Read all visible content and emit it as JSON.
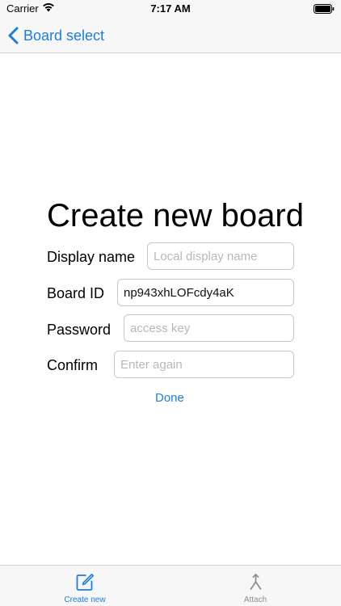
{
  "status_bar": {
    "carrier": "Carrier",
    "time": "7:17 AM"
  },
  "nav": {
    "back_label": "Board select"
  },
  "form": {
    "title": "Create new board",
    "fields": [
      {
        "label": "Display name",
        "value": "",
        "placeholder": "Local display name"
      },
      {
        "label": "Board ID",
        "value": "np943xhLOFcdy4aK",
        "placeholder": ""
      },
      {
        "label": "Password",
        "value": "",
        "placeholder": "access key"
      },
      {
        "label": "Confirm",
        "value": "",
        "placeholder": "Enter again"
      }
    ],
    "done_label": "Done"
  },
  "tabs": [
    {
      "label": "Create new",
      "icon": "compose-icon",
      "active": true
    },
    {
      "label": "Attach",
      "icon": "merge-icon",
      "active": false
    }
  ],
  "colors": {
    "accent": "#1a7fe0",
    "inactive": "#8e8e93"
  }
}
